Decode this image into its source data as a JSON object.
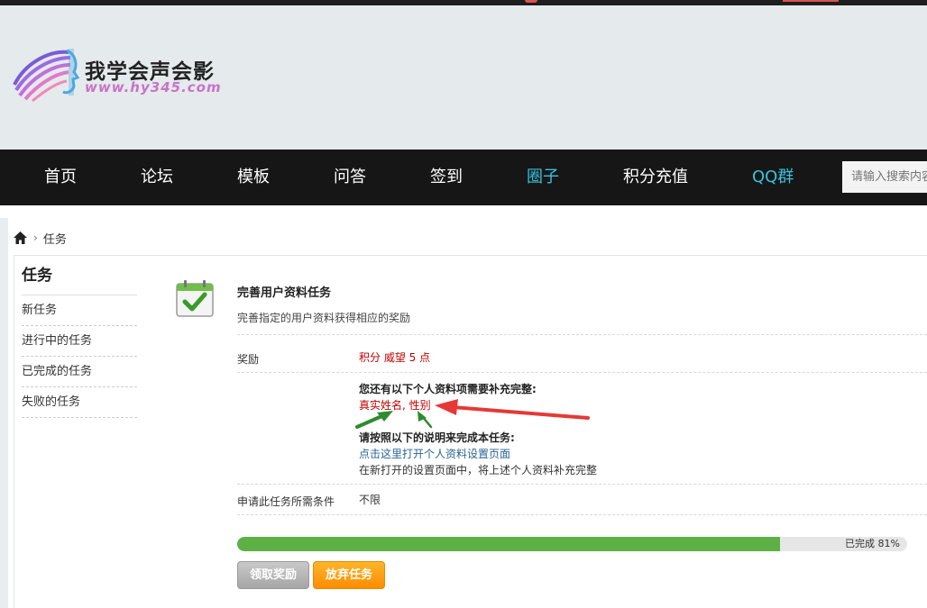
{
  "logo": {
    "title": "我学会声会影",
    "url": "www.hy345.com"
  },
  "nav": {
    "items": [
      {
        "label": "首页"
      },
      {
        "label": "论坛"
      },
      {
        "label": "模板"
      },
      {
        "label": "问答"
      },
      {
        "label": "签到"
      },
      {
        "label": "圈子"
      },
      {
        "label": "积分充值"
      },
      {
        "label": "QQ群"
      }
    ],
    "search_placeholder": "请输入搜索内容"
  },
  "breadcrumb": {
    "current": "任务"
  },
  "sidebar": {
    "title": "任务",
    "items": [
      {
        "label": "新任务"
      },
      {
        "label": "进行中的任务"
      },
      {
        "label": "已完成的任务"
      },
      {
        "label": "失败的任务"
      }
    ]
  },
  "task": {
    "title": "完善用户资料任务",
    "description": "完善指定的用户资料获得相应的奖励",
    "reward_label": "奖励",
    "reward_value": "积分 威望 5 点",
    "missing_heading": "您还有以下个人资料项需要补充完整:",
    "missing_items": "真实姓名, 性别",
    "instructions_heading": "请按照以下的说明来完成本任务:",
    "instructions_link": "点击这里打开个人资料设置页面",
    "instructions_note": "在新打开的设置页面中，将上述个人资料补充完整",
    "condition_label": "申请此任务所需条件",
    "condition_value": "不限",
    "progress_percent": 81,
    "progress_text": "已完成 81%"
  },
  "buttons": {
    "claim": "领取奖励",
    "abandon": "放弃任务"
  },
  "colors": {
    "nav_bg": "#161616",
    "nav_highlight": "#39c3df",
    "progress": "#5cb044",
    "accent_red": "#c00000"
  }
}
